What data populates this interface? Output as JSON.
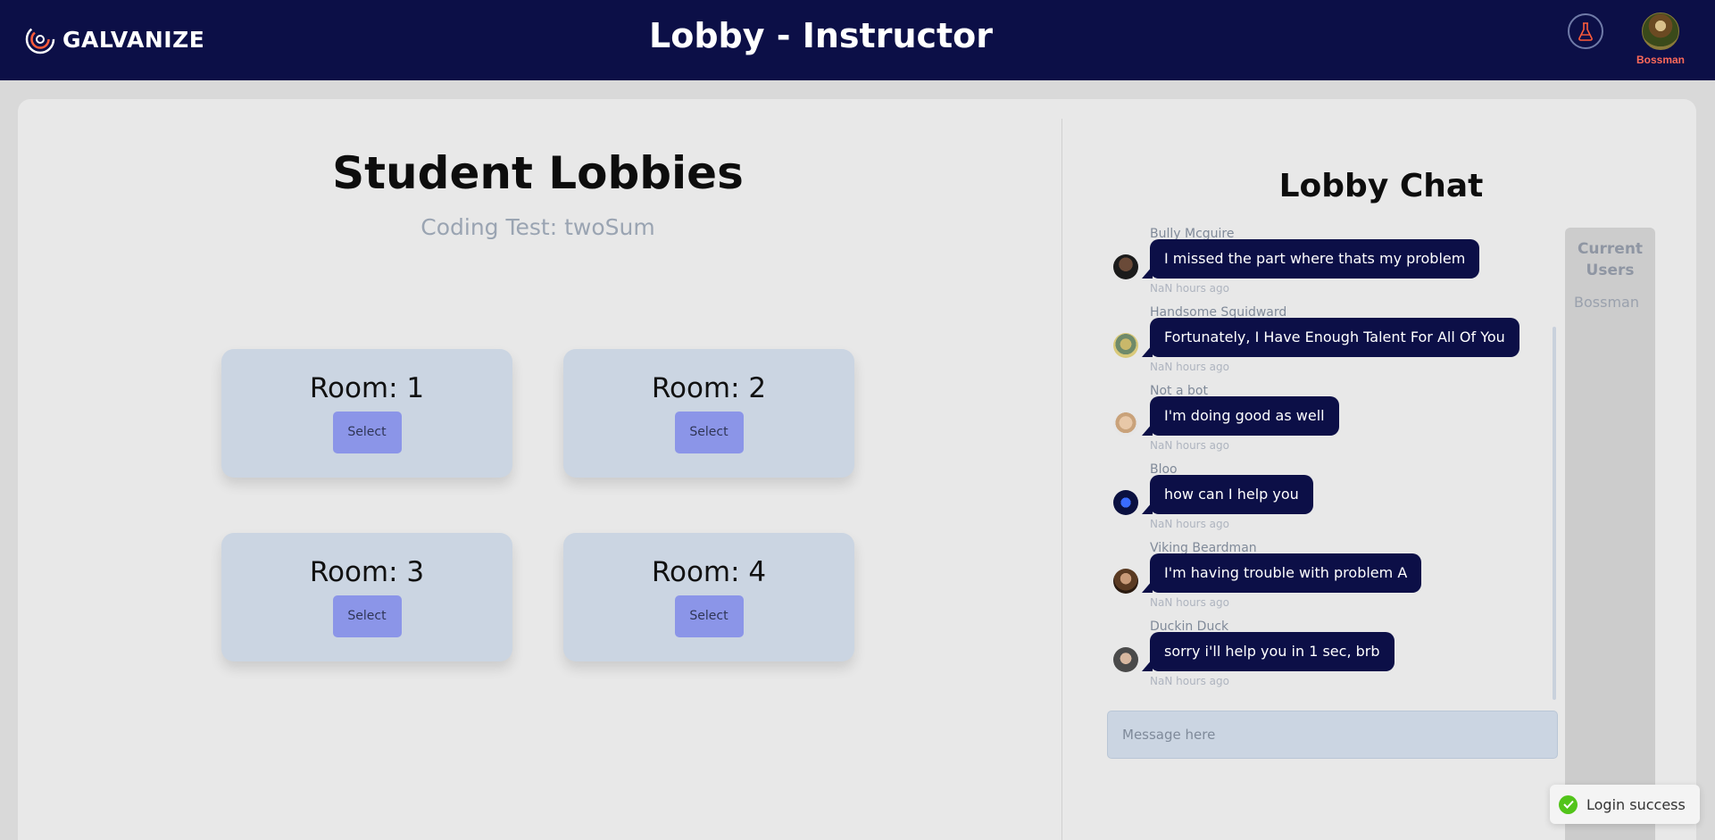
{
  "header": {
    "brand": "GALVANIZE",
    "title": "Lobby - Instructor",
    "lab_icon": "flask-icon",
    "user": {
      "name": "Bossman"
    }
  },
  "lobbies": {
    "title": "Student Lobbies",
    "subtitle": "Coding Test: twoSum",
    "rooms": [
      {
        "label": "Room: 1",
        "button": "Select"
      },
      {
        "label": "Room: 2",
        "button": "Select"
      },
      {
        "label": "Room: 3",
        "button": "Select"
      },
      {
        "label": "Room: 4",
        "button": "Select"
      }
    ]
  },
  "chat": {
    "title": "Lobby Chat",
    "messages": [
      {
        "author": "Bully Mcguire",
        "text": "I missed the part where thats my problem",
        "time": "NaN hours ago"
      },
      {
        "author": "Handsome Squidward",
        "text": "Fortunately, I Have Enough Talent For All Of You",
        "time": "NaN hours ago"
      },
      {
        "author": "Not a bot",
        "text": "I'm doing good as well",
        "time": "NaN hours ago"
      },
      {
        "author": "Bloo",
        "text": "how can I help you",
        "time": "NaN hours ago"
      },
      {
        "author": "Viking Beardman",
        "text": "I'm having trouble with problem A",
        "time": "NaN hours ago"
      },
      {
        "author": "Duckin Duck",
        "text": "sorry i'll help you in 1 sec, brb",
        "time": "NaN hours ago"
      }
    ],
    "input_placeholder": "Message here",
    "users_panel": {
      "title": "Current Users",
      "users": [
        "Bossman"
      ]
    }
  },
  "toast": {
    "text": "Login success"
  },
  "colors": {
    "nav": "#0c0f47",
    "bubble": "#0c0f47",
    "select_button": "#8b95e8",
    "room_card": "#cbd5e2",
    "success": "#52c41a"
  }
}
